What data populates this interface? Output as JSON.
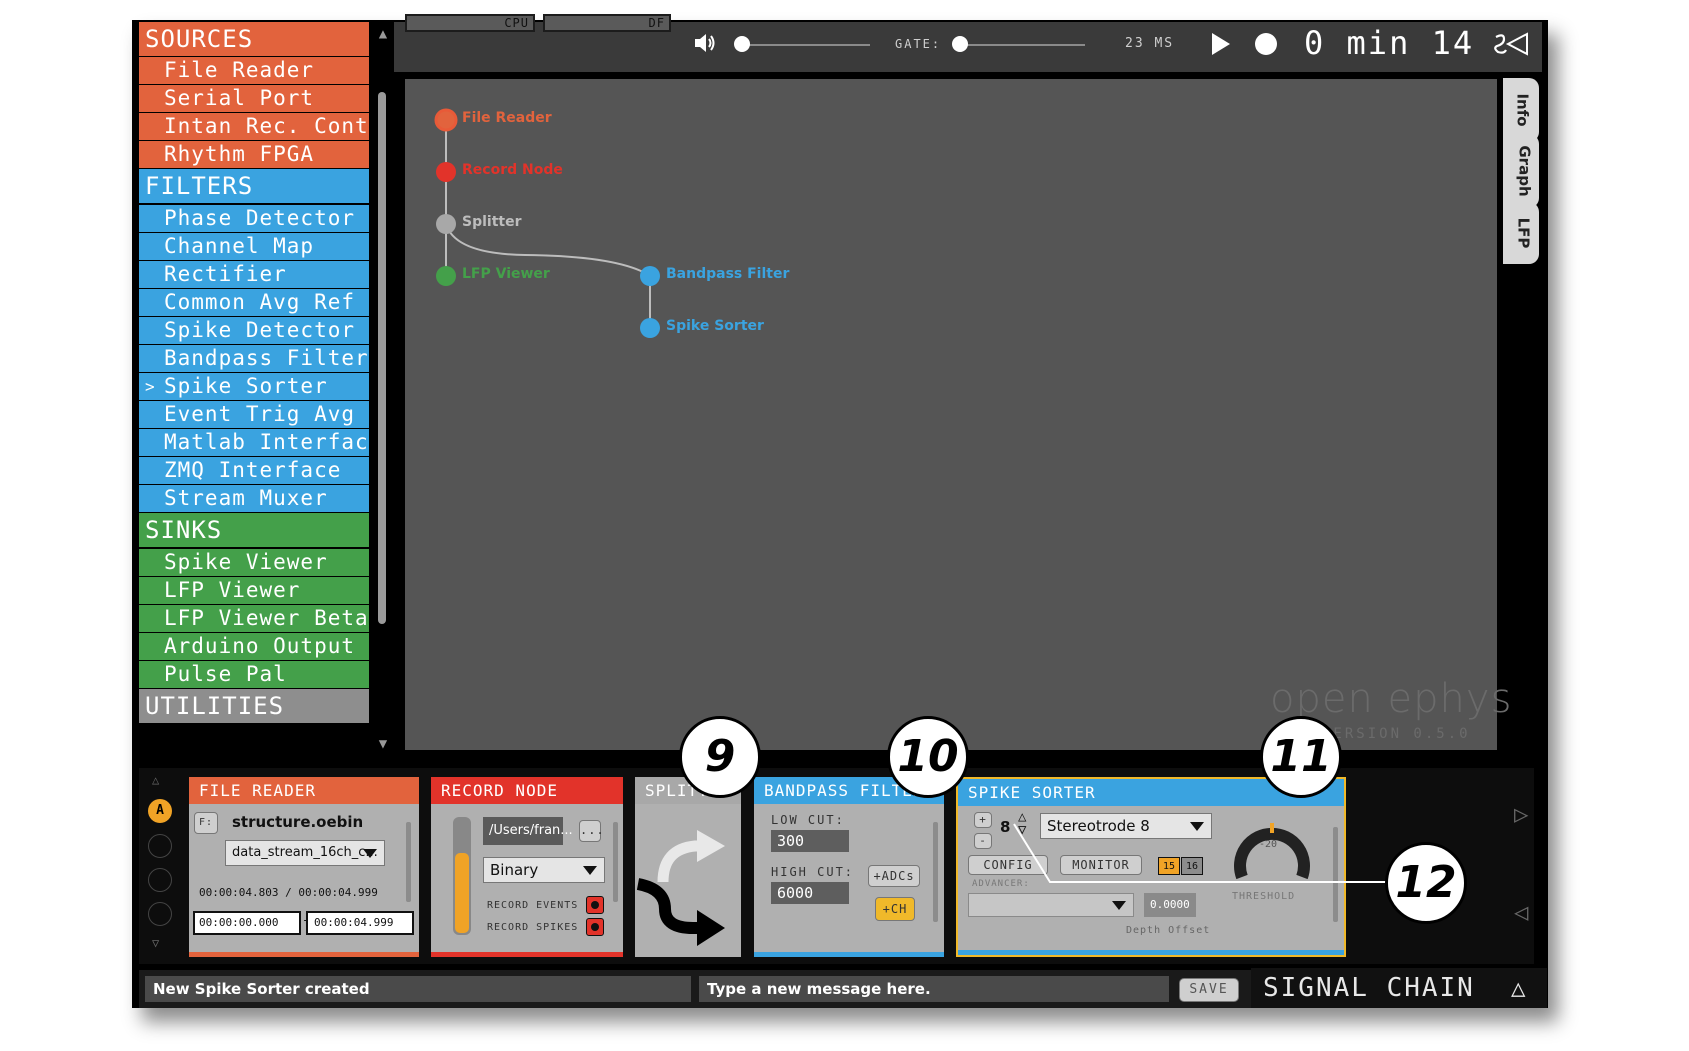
{
  "processor_list": {
    "sources": {
      "label": "SOURCES",
      "items": [
        "File Reader",
        "Serial Port",
        "Intan Rec. Controller",
        "Rhythm FPGA"
      ]
    },
    "filters": {
      "label": "FILTERS",
      "items": [
        "Phase Detector",
        "Channel Map",
        "Rectifier",
        "Common Avg Ref",
        "Spike Detector",
        "Bandpass Filter",
        "Spike Sorter",
        "Event Trig Avg",
        "Matlab Interface",
        "ZMQ Interface",
        "Stream Muxer"
      ],
      "selected_marker": ">"
    },
    "sinks": {
      "label": "SINKS",
      "items": [
        "Spike Viewer",
        "LFP Viewer",
        "LFP Viewer Beta",
        "Arduino Output",
        "Pulse Pal"
      ]
    },
    "utilities": {
      "label": "UTILITIES"
    }
  },
  "toolbar": {
    "cpu_label": "CPU",
    "df_label": "DF",
    "volume_icon": "speaker-icon",
    "gate_label": "GATE:",
    "latency": "23 MS",
    "clock_min": "0",
    "clock_min_unit": "min",
    "clock_sec": "14"
  },
  "graph": {
    "nodes": [
      {
        "label": "File Reader",
        "color": "#e2633d"
      },
      {
        "label": "Record Node",
        "color": "#e2332a"
      },
      {
        "label": "Splitter",
        "color": "#a8a8a8"
      },
      {
        "label": "LFP Viewer",
        "color": "#44a04a"
      },
      {
        "label": "Bandpass Filter",
        "color": "#3aa3e0"
      },
      {
        "label": "Spike Sorter",
        "color": "#3aa3e0"
      }
    ],
    "logo": "open ephys",
    "version": "VERSION 0.5.0"
  },
  "side_tabs": [
    "Info",
    "Graph",
    "LFP"
  ],
  "editors": {
    "file_reader": {
      "title": "FILE READER",
      "folder_btn": "F:",
      "file": "structure.oebin",
      "stream": "data_stream_16ch_c...",
      "current_time": "00:00:04.803",
      "separator": "/",
      "total_time": "00:00:04.999",
      "start": "00:00:00.000",
      "range_sep": "-",
      "end": "00:00:04.999"
    },
    "record_node": {
      "title": "RECORD NODE",
      "path": "/Users/fran...",
      "browse": "...",
      "format": "Binary",
      "record_events": "RECORD EVENTS",
      "record_spikes": "RECORD SPIKES"
    },
    "splitter": {
      "title": "SPLITTER"
    },
    "bandpass": {
      "title": "BANDPASS FILTER",
      "low_cut_label": "LOW CUT:",
      "low_cut": "300",
      "high_cut_label": "HIGH CUT:",
      "high_cut": "6000",
      "adcs_btn": "+ADCs",
      "ch_btn": "+CH"
    },
    "spike_sorter": {
      "title": "SPIKE SORTER",
      "plus": "+",
      "minus": "-",
      "count": "8",
      "electrode": "Stereotrode 8",
      "config_btn": "CONFIG",
      "monitor_btn": "MONITOR",
      "chan_a": "15",
      "chan_b": "16",
      "advancer_label": "ADVANCER:",
      "depth_value": "0.0000",
      "depth_label": "Depth Offset",
      "threshold_value": "-20",
      "threshold_label": "THRESHOLD"
    }
  },
  "selector": {
    "badge": "A"
  },
  "callouts": [
    "9",
    "10",
    "11",
    "12"
  ],
  "messages": {
    "status": "New Spike Sorter created",
    "input_placeholder": "Type a new message here.",
    "save": "SAVE"
  },
  "signal_chain": "SIGNAL CHAIN"
}
